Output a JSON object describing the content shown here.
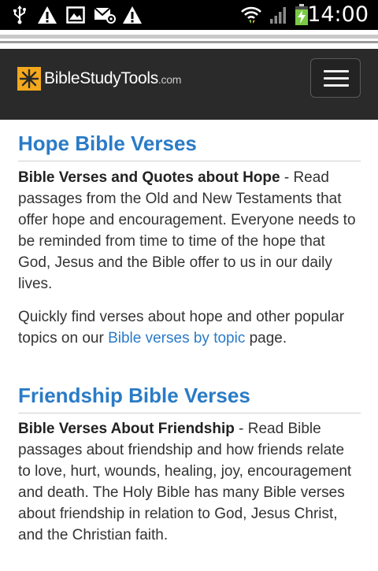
{
  "status_bar": {
    "time": "14:00",
    "icons": [
      "usb-icon",
      "warning-icon",
      "image-icon",
      "email-at-icon",
      "warning-icon",
      "wifi-icon",
      "signal-icon",
      "battery-charging-icon"
    ]
  },
  "header": {
    "logo_text": "BibleStudyTools",
    "logo_suffix": ".com",
    "menu_icon": "hamburger-menu-icon"
  },
  "sections": [
    {
      "title": "Hope Bible Verses",
      "lead_bold": "Bible Verses and Quotes about Hope",
      "lead_text": " - Read passages from the Old and New Testaments that offer hope and encouragement. Everyone needs to be reminded from time to time of the hope that God, Jesus and the Bible offer to us in our daily lives.",
      "second_pre": "Quickly find verses about hope and other popular topics on our ",
      "second_link": "Bible verses by topic",
      "second_post": " page."
    },
    {
      "title": "Friendship Bible Verses",
      "lead_bold": "Bible Verses About Friendship",
      "lead_text": " - Read Bible passages about friendship and how friends relate to love, hurt, wounds, healing, joy, encouragement and death. The Holy Bible has many Bible verses about friendship in relation to God, Jesus Christ, and the Christian faith."
    }
  ],
  "colors": {
    "link": "#2a7bc6",
    "header_bg": "#2a2a2a",
    "logo_mark": "#f4a81d"
  }
}
